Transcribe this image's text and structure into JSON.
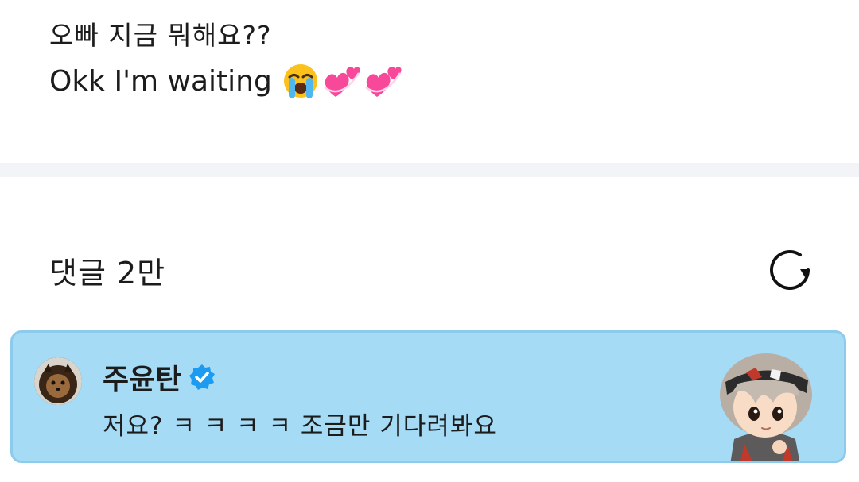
{
  "post": {
    "line1": "오빠 지금 뭐해요??",
    "line2": "Okk I'm waiting",
    "emojis": [
      "loudly-crying-face",
      "two-hearts",
      "two-hearts"
    ]
  },
  "comments": {
    "title": "댓글 2만",
    "refresh_icon": "refresh-icon"
  },
  "comment": {
    "username": "주윤탄",
    "verified": true,
    "text": "저요? ㅋ ㅋ ㅋ ㅋ 조금만 기다려봐요",
    "avatar_icon": "pomeranian-dog-avatar",
    "sticker_icon": "chibi-character-sticker"
  },
  "colors": {
    "card_bg": "#a6dbf6",
    "card_border": "#8ccbec",
    "divider": "#f2f4f7",
    "verified_blue": "#1d9bf0"
  }
}
